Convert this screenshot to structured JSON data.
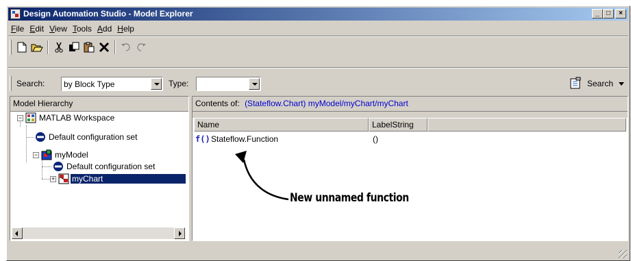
{
  "window": {
    "title": "Design Automation Studio - Model Explorer",
    "buttons": {
      "minimize": "_",
      "maximize": "□",
      "close": "×"
    }
  },
  "menu": [
    {
      "label": "File",
      "u": "F",
      "rest": "ile"
    },
    {
      "label": "Edit",
      "u": "E",
      "rest": "dit"
    },
    {
      "label": "View",
      "u": "V",
      "rest": "iew"
    },
    {
      "label": "Tools",
      "u": "T",
      "rest": "ools"
    },
    {
      "label": "Add",
      "u": "A",
      "rest": "dd"
    },
    {
      "label": "Help",
      "u": "H",
      "rest": "elp"
    }
  ],
  "toolbar": {
    "icons": [
      "new-icon",
      "open-icon",
      "cut-icon",
      "copy-icon",
      "paste-icon",
      "delete-icon",
      "undo-icon",
      "redo-icon"
    ]
  },
  "search": {
    "search_label": "Search:",
    "search_value": "by Block Type",
    "type_label": "Type:",
    "type_value": "",
    "button_label": "Search"
  },
  "hierarchy": {
    "header": "Model Hierarchy",
    "items": [
      {
        "label": "MATLAB Workspace"
      },
      {
        "label": "Default configuration set"
      },
      {
        "label": "myModel"
      },
      {
        "label": "Default configuration set"
      },
      {
        "label": "myChart"
      }
    ]
  },
  "contents": {
    "header_prefix": "Contents of:",
    "header_path": "(Stateflow.Chart) myModel/myChart/myChart",
    "columns": [
      "Name",
      "LabelString"
    ],
    "rows": [
      {
        "icon_text": "f()",
        "name": "Stateflow.Function",
        "label": "()"
      }
    ]
  },
  "annotation": {
    "text": "New unnamed function"
  },
  "colors": {
    "selection": "#0a246a",
    "link": "#0000cc",
    "face": "#d4d0c8"
  }
}
